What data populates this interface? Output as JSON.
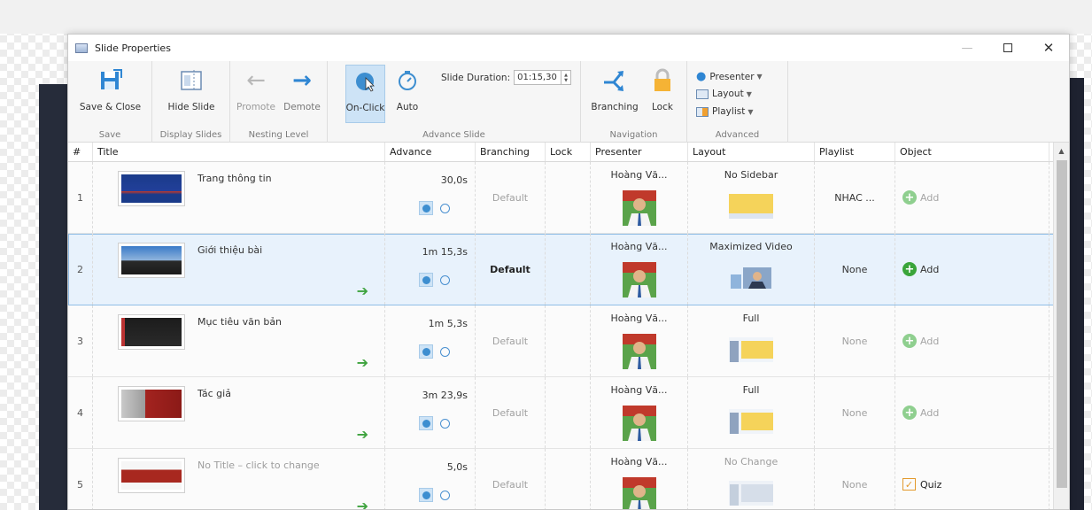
{
  "window": {
    "title": "Slide Properties"
  },
  "ribbon": {
    "save_group": {
      "label": "Save",
      "save_close": "Save & Close"
    },
    "display_group": {
      "label": "Display Slides",
      "hide_slide": "Hide Slide"
    },
    "nesting_group": {
      "label": "Nesting Level",
      "promote": "Promote",
      "demote": "Demote"
    },
    "advance_group": {
      "label": "Advance Slide",
      "on_click": "On-Click",
      "auto": "Auto",
      "duration_label": "Slide Duration:",
      "duration_value": "01:15,30"
    },
    "navigation_group": {
      "label": "Navigation",
      "branching": "Branching",
      "lock": "Lock"
    },
    "advanced_group": {
      "label": "Advanced",
      "presenter": "Presenter",
      "layout": "Layout",
      "playlist": "Playlist"
    }
  },
  "columns": [
    "#",
    "Title",
    "Advance",
    "Branching",
    "Lock",
    "Presenter",
    "Layout",
    "Playlist",
    "Object"
  ],
  "rows": [
    {
      "num": "1",
      "title": "Trang thông tin",
      "advance": "30,0s",
      "branching": "Default",
      "presenter": "Hoàng Vă...",
      "layout": "No Sidebar",
      "playlist": "NHAC ...",
      "object": "Add"
    },
    {
      "num": "2",
      "title": "Giới thiệu bài",
      "advance": "1m 15,3s",
      "branching": "Default",
      "presenter": "Hoàng Vă...",
      "layout": "Maximized Video",
      "playlist": "None",
      "object": "Add"
    },
    {
      "num": "3",
      "title": "Mục tiêu văn bản",
      "advance": "1m 5,3s",
      "branching": "Default",
      "presenter": "Hoàng Vă...",
      "layout": "Full",
      "playlist": "None",
      "object": "Add"
    },
    {
      "num": "4",
      "title": "Tác giả",
      "advance": "3m 23,9s",
      "branching": "Default",
      "presenter": "Hoàng Vă...",
      "layout": "Full",
      "playlist": "None",
      "object": "Add"
    },
    {
      "num": "5",
      "title": "No Title – click to change",
      "advance": "5,0s",
      "branching": "Default",
      "presenter": "Hoàng Vă...",
      "layout": "No Change",
      "playlist": "None",
      "object": "Quiz"
    }
  ],
  "colors": {
    "accent": "#3d8ed0",
    "selection": "#e8f2fc",
    "green": "#3aa53a",
    "quiz": "#e39a2d"
  }
}
